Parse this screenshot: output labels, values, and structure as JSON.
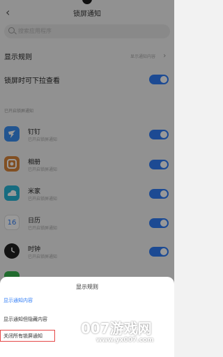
{
  "header": {
    "back_glyph": "‹",
    "title": "锁屏通知"
  },
  "search": {
    "placeholder": "搜索应用程序"
  },
  "settings": {
    "display_rule": {
      "label": "显示规则",
      "value": "显示通知内容"
    },
    "pull_down": {
      "label": "锁屏时可下拉查看",
      "enabled": true
    }
  },
  "section_title": "已开启锁屏通知",
  "apps": [
    {
      "name": "钉钉",
      "sub": "已开启锁屏通知",
      "icon": "dingtalk-icon",
      "color": "#3a8ef0",
      "enabled": true
    },
    {
      "name": "相册",
      "sub": "已开启锁屏通知",
      "icon": "gallery-icon",
      "color": "#d8843a",
      "enabled": true
    },
    {
      "name": "米家",
      "sub": "已开启锁屏通知",
      "icon": "mihome-icon",
      "color": "#27b5d6",
      "enabled": true
    },
    {
      "name": "日历",
      "sub": "已开启锁屏通知",
      "icon": "calendar-icon",
      "day": "16",
      "color": "#ffffff",
      "enabled": true
    },
    {
      "name": "时钟",
      "sub": "已开启锁屏通知",
      "icon": "clock-icon",
      "color": "#202020",
      "enabled": true
    }
  ],
  "sheet": {
    "title": "显示规则",
    "options": [
      {
        "label": "显示通知内容",
        "selected": true
      },
      {
        "label": "显示通知但隐藏内容",
        "selected": false
      },
      {
        "label": "关闭所有锁屏通知",
        "selected": false
      }
    ]
  },
  "watermark": {
    "brand": "007游戏网",
    "url": "www.yx007.com"
  },
  "colors": {
    "accent": "#2f7cf6",
    "highlight": "#e54747"
  }
}
